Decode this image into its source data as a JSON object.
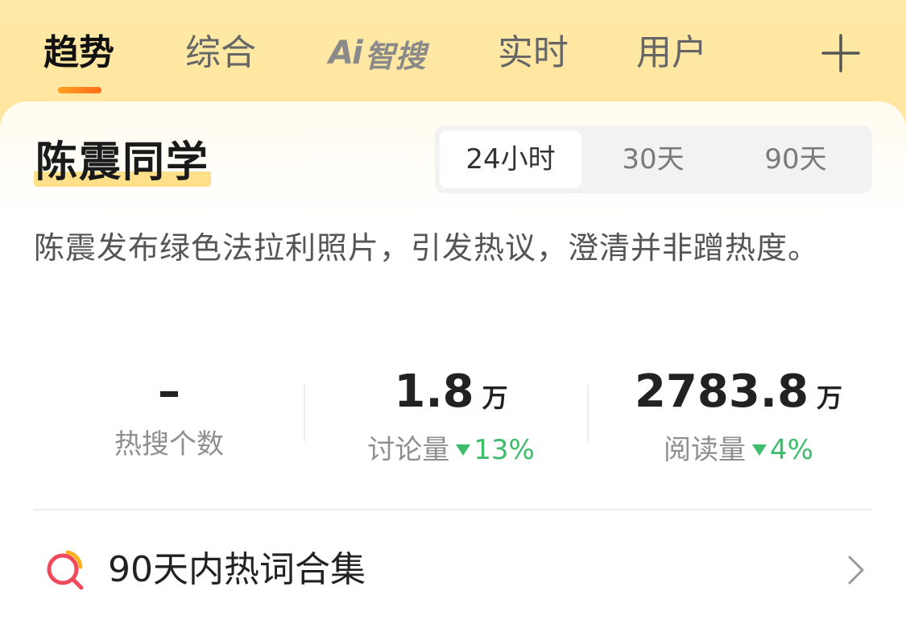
{
  "tabs": [
    {
      "label": "趋势",
      "active": true
    },
    {
      "label": "综合",
      "active": false
    },
    {
      "label": "Ai智搜",
      "ai_mark": "Ai",
      "ai_text": "智搜",
      "active": false
    },
    {
      "label": "实时",
      "active": false
    },
    {
      "label": "用户",
      "active": false
    }
  ],
  "add_icon": "plus-icon",
  "topic": {
    "title": "陈震同学",
    "summary": "陈震发布绿色法拉利照片，引发热议，澄清并非蹭热度。"
  },
  "time_range": {
    "options": [
      "24小时",
      "30天",
      "90天"
    ],
    "selected": "24小时"
  },
  "stats": [
    {
      "value": "–",
      "unit": "",
      "label": "热搜个数",
      "trend": "",
      "trend_dir": ""
    },
    {
      "value": "1.8",
      "unit": "万",
      "label": "讨论量",
      "trend": "13%",
      "trend_dir": "down"
    },
    {
      "value": "2783.8",
      "unit": "万",
      "label": "阅读量",
      "trend": "4%",
      "trend_dir": "down"
    }
  ],
  "colors": {
    "accent_orange": "#ff7a1a",
    "trend_green": "#3dbd6b",
    "title_highlight": "#ffe08a"
  },
  "hot_words": {
    "label": "90天内热词合集",
    "icon": "search-hot-icon"
  }
}
